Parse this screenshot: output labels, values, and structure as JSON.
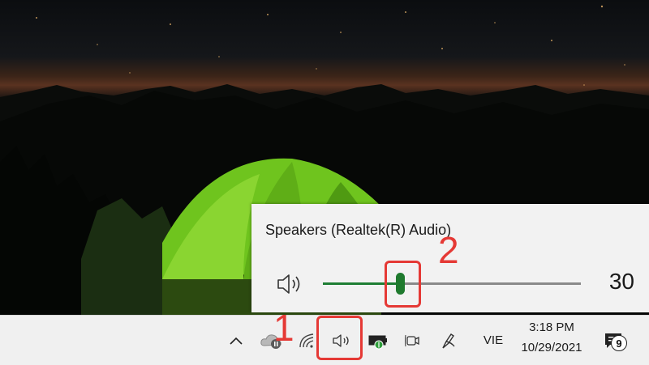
{
  "volume_flyout": {
    "device_name": "Speakers (Realtek(R) Audio)",
    "volume_value": "30",
    "volume_level": 30
  },
  "taskbar": {
    "language": "VIE",
    "time": "3:18 PM",
    "date": "10/29/2021",
    "notification_count": "9",
    "icons": [
      "chevron-up-icon",
      "onedrive-paused-icon",
      "wifi-icon",
      "speaker-icon",
      "battery-icon",
      "meet-now-icon",
      "pen-icon",
      "action-center-icon"
    ]
  },
  "annotations": {
    "step1": "1",
    "step2": "2",
    "color": "#e53935"
  },
  "colors": {
    "slider_fill": "#1e7e34",
    "taskbar_bg": "#f0f0f0",
    "flyout_bg": "#f2f2f2"
  }
}
